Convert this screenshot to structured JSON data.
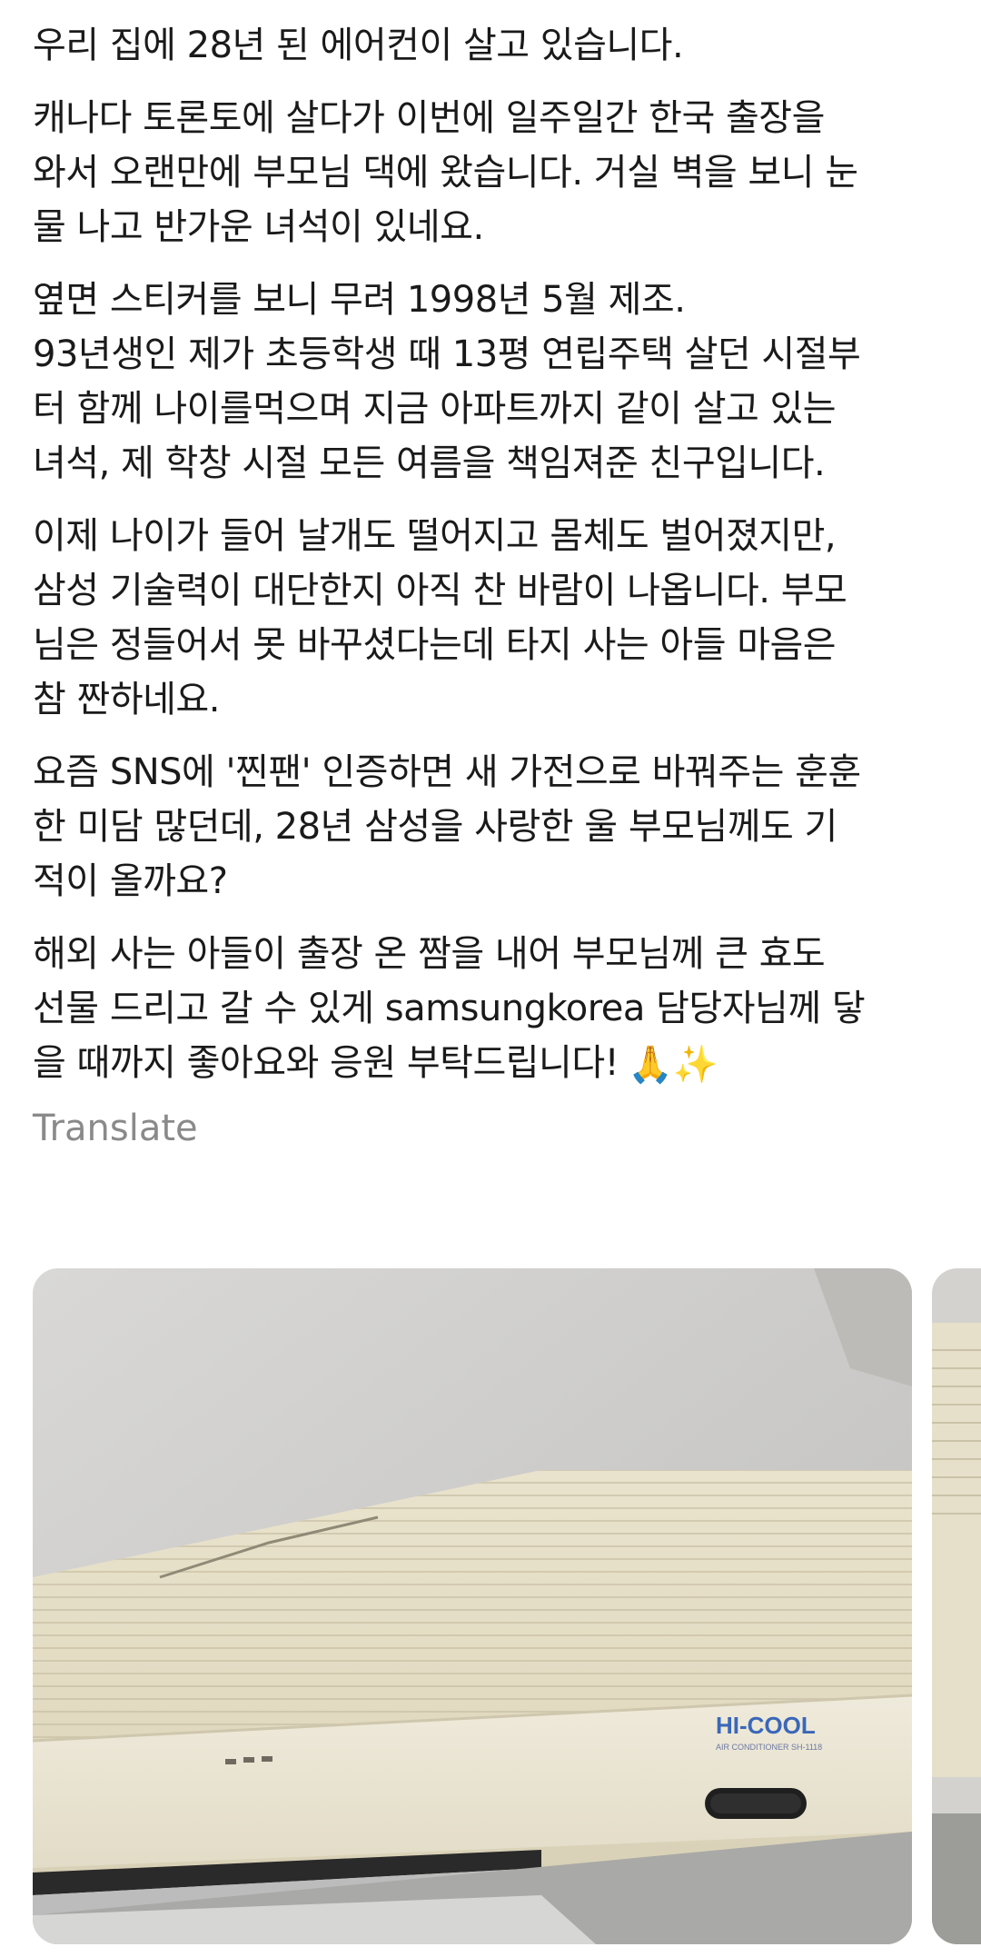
{
  "post": {
    "paragraphs": [
      [
        "우리 집에 28년 된 에어컨이 살고 있습니다."
      ],
      [
        "캐나다 토론토에 살다가 이번에 일주일간 한국 출장을",
        "와서 오랜만에 부모님 댁에 왔습니다. 거실 벽을 보니 눈",
        "물 나고 반가운 녀석이 있네요."
      ],
      [
        "옆면 스티커를 보니 무려 1998년 5월 제조.",
        "93년생인 제가 초등학생 때 13평 연립주택 살던 시절부",
        "터 함께 나이를먹으며 지금 아파트까지 같이 살고 있는",
        "녀석, 제 학창 시절 모든 여름을 책임져준 친구입니다."
      ],
      [
        "이제 나이가 들어 날개도 떨어지고 몸체도 벌어졌지만,",
        "삼성 기술력이 대단한지 아직 찬 바람이 나옵니다. 부모",
        "님은 정들어서 못 바꾸셨다는데 타지 사는 아들 마음은",
        "참 짠하네요."
      ],
      [
        "요즘 SNS에 '찐팬' 인증하면 새 가전으로 바꿔주는 훈훈",
        "한 미담 많던데, 28년 삼성을 사랑한 울 부모님께도 기",
        "적이 올까요?"
      ],
      [
        "해외 사는 아들이 출장 온 짬을 내어 부모님께 큰 효도",
        "선물 드리고 갈 수 있게 samsungkorea 담당자님께 닿",
        "을 때까지 좋아요와 응원 부탁드립니다!"
      ]
    ],
    "closing_emoji": "🙏✨",
    "translate_label": "Translate"
  },
  "gallery": {
    "photo_brand_label": "HI-COOL",
    "photo_sub_label": "AIR CONDITIONER SH-1118"
  },
  "colors": {
    "text": "#1a1a1a",
    "translate": "#8a8a8a",
    "wall": "#cfcfce",
    "unit": "#e6dfc9",
    "brand": "#3a67b8"
  }
}
